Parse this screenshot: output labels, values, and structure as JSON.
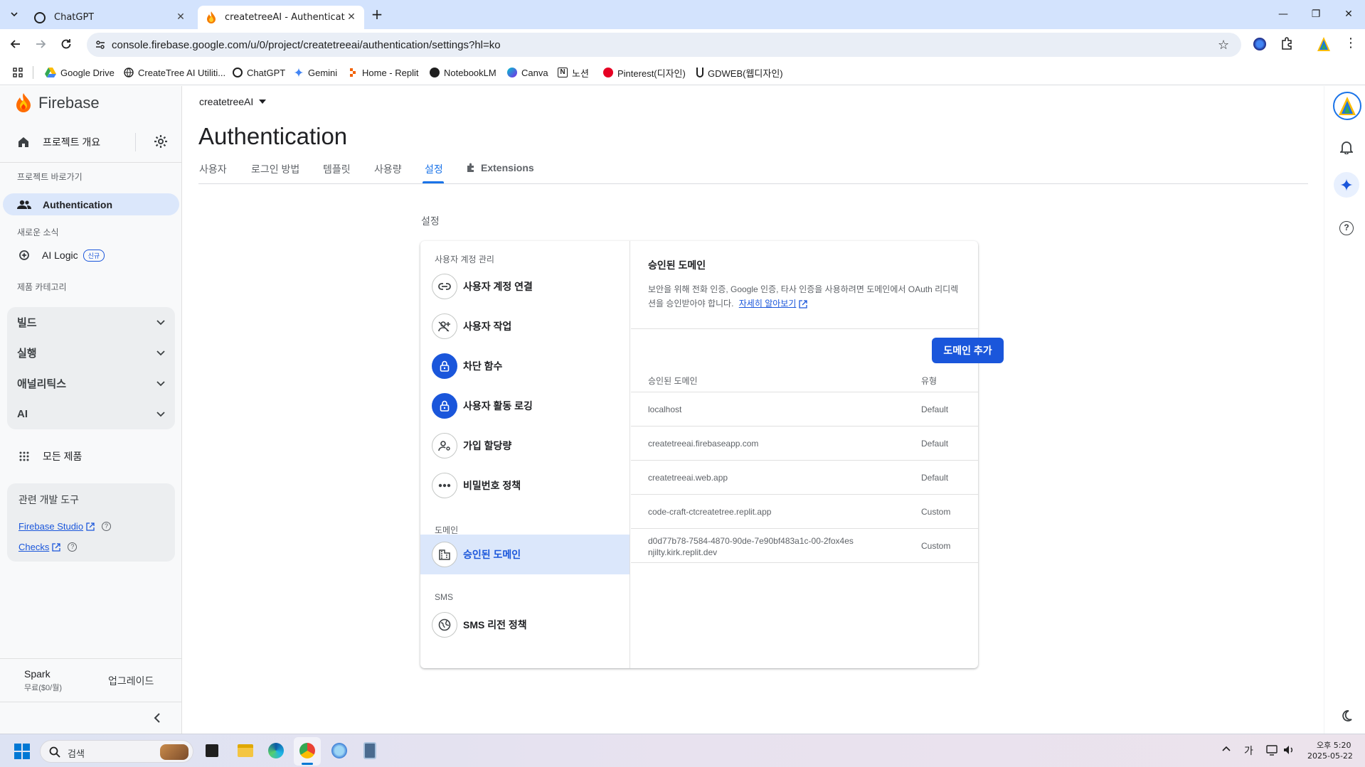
{
  "browser": {
    "tabs": [
      {
        "title": "ChatGPT",
        "active": false
      },
      {
        "title": "createtreeAI - Authentication",
        "active": true
      }
    ],
    "new_tab": "+",
    "url": "console.firebase.google.com/u/0/project/createtreeai/authentication/settings?hl=ko",
    "bookmarks": [
      {
        "label": "Google Drive",
        "icon": "google-drive-icon"
      },
      {
        "label": "CreateTree AI Utiliti...",
        "icon": "globe-icon"
      },
      {
        "label": "ChatGPT",
        "icon": "chatgpt-icon"
      },
      {
        "label": "Gemini",
        "icon": "gemini-icon"
      },
      {
        "label": "Home - Replit",
        "icon": "replit-icon"
      },
      {
        "label": "NotebookLM",
        "icon": "notebooklm-icon"
      },
      {
        "label": "Canva",
        "icon": "canva-icon"
      },
      {
        "label": "노션",
        "icon": "notion-icon"
      },
      {
        "label": "Pinterest(디자인)",
        "icon": "pinterest-icon"
      },
      {
        "label": "GDWEB(웹디자인)",
        "icon": "gdweb-icon"
      }
    ]
  },
  "sidebar": {
    "brand": "Firebase",
    "overview": "프로젝트 개요",
    "shortcuts_label": "프로젝트 바로가기",
    "auth_item": "Authentication",
    "news_label": "새로운 소식",
    "ai_logic": "AI Logic",
    "new_badge": "신규",
    "category_label": "제품 카테고리",
    "groups": [
      "빌드",
      "실행",
      "애널리틱스",
      "AI"
    ],
    "all_products": "모든 제품",
    "dev_tools": {
      "title": "관련 개발 도구",
      "links": [
        "Firebase Studio",
        "Checks"
      ]
    },
    "plan": {
      "name": "Spark",
      "price": "무료($0/월)",
      "upgrade": "업그레이드"
    }
  },
  "main": {
    "project": "createtreeAI",
    "title": "Authentication",
    "tabs": [
      "사용자",
      "로그인 방법",
      "템플릿",
      "사용량",
      "설정",
      "Extensions"
    ],
    "active_tab": "설정",
    "section_label": "설정"
  },
  "settings_nav": {
    "sections": [
      {
        "label": "사용자 계정 관리",
        "items": [
          {
            "label": "사용자 계정 연결",
            "icon": "link-icon"
          },
          {
            "label": "사용자 작업",
            "icon": "person-add-icon"
          },
          {
            "label": "차단 함수",
            "icon": "lock-icon"
          },
          {
            "label": "사용자 활동 로깅",
            "icon": "lock-icon"
          },
          {
            "label": "가입 할당량",
            "icon": "person-settings-icon"
          },
          {
            "label": "비밀번호 정책",
            "icon": "password-icon"
          }
        ]
      },
      {
        "label": "도메인",
        "items": [
          {
            "label": "승인된 도메인",
            "icon": "domain-icon"
          }
        ]
      },
      {
        "label": "SMS",
        "items": [
          {
            "label": "SMS 리전 정책",
            "icon": "globe-icon"
          }
        ]
      }
    ],
    "selected": "승인된 도메인"
  },
  "domains_panel": {
    "title": "승인된 도메인",
    "description": "보안을 위해 전화 인증, Google 인증, 타사 인증을 사용하려면 도메인에서 OAuth 리디렉션을 승인받아야 합니다.",
    "learn_more": "자세히 알아보기",
    "add_button": "도메인 추가",
    "columns": [
      "승인된 도메인",
      "유형"
    ],
    "rows": [
      {
        "domain": "localhost",
        "type": "Default"
      },
      {
        "domain": "createtreeai.firebaseapp.com",
        "type": "Default"
      },
      {
        "domain": "createtreeai.web.app",
        "type": "Default"
      },
      {
        "domain": "code-craft-ctcreatetree.replit.app",
        "type": "Custom"
      },
      {
        "domain": "d0d77b78-7584-4870-90de-7e90bf483a1c-00-2fox4esnjilty.kirk.replit.dev",
        "type": "Custom"
      }
    ]
  },
  "taskbar": {
    "search_placeholder": "검색",
    "ime": "가",
    "time": "오후 5:20",
    "date": "2025-05-22"
  },
  "colors": {
    "accent": "#1a73e8",
    "primary_button": "#1a56db",
    "selected_bg": "#dbe7fb",
    "tabstrip": "#d3e3fd"
  }
}
